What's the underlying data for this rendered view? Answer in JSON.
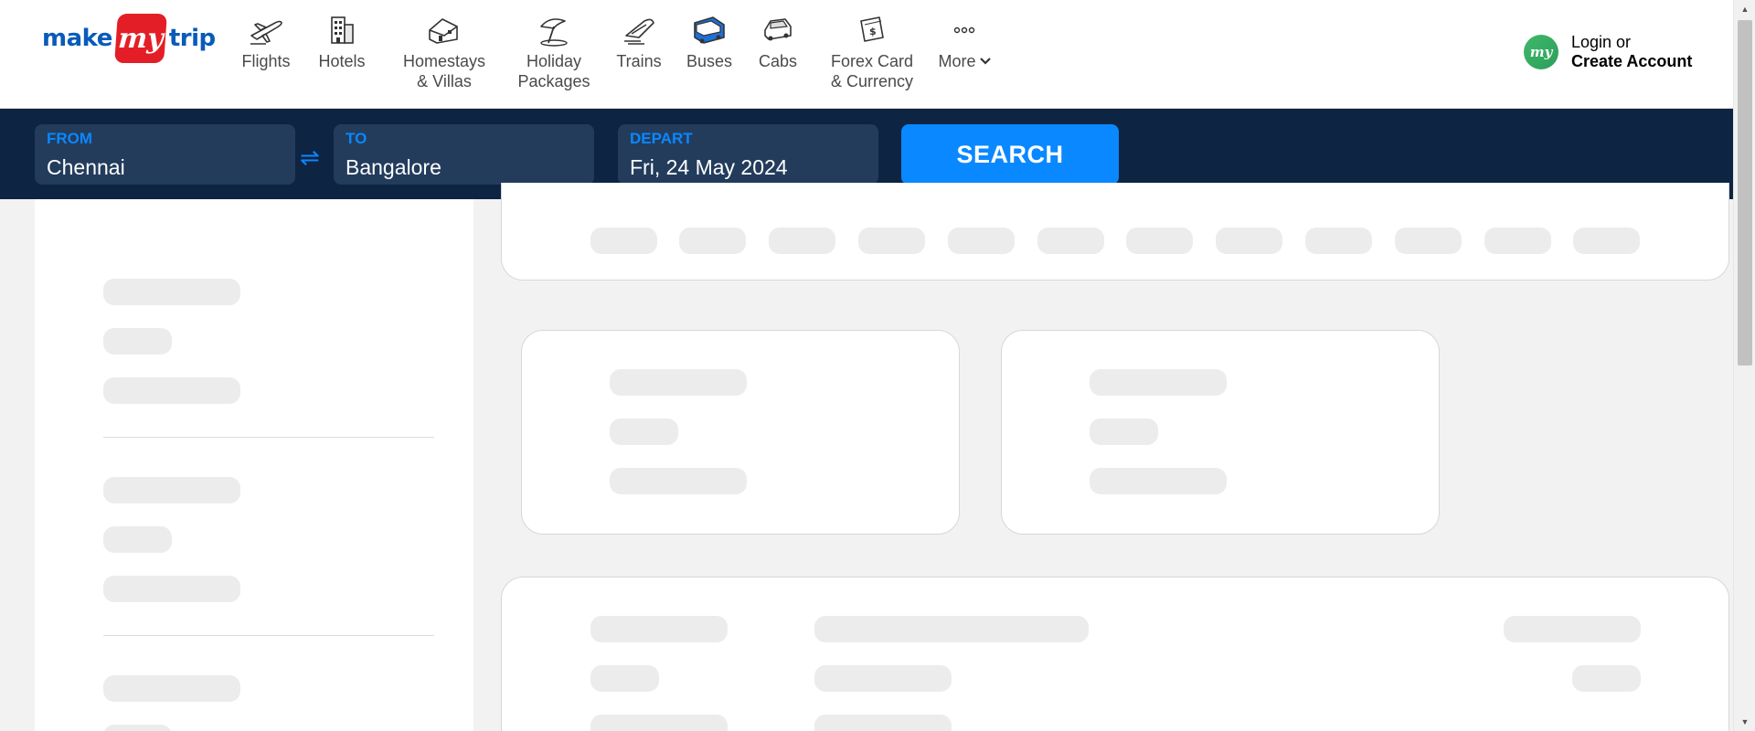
{
  "logo": {
    "pre": "make",
    "badge": "my",
    "post": "trip"
  },
  "nav": [
    {
      "label": "Flights",
      "icon": "flight-icon"
    },
    {
      "label": "Hotels",
      "icon": "hotel-icon"
    },
    {
      "label": "Homestays\n& Villas",
      "icon": "homestay-icon"
    },
    {
      "label": "Holiday\nPackages",
      "icon": "holiday-icon"
    },
    {
      "label": "Trains",
      "icon": "train-icon"
    },
    {
      "label": "Buses",
      "icon": "bus-icon"
    },
    {
      "label": "Cabs",
      "icon": "cab-icon"
    },
    {
      "label": "Forex Card\n& Currency",
      "icon": "forex-icon"
    },
    {
      "label": "More",
      "icon": "more-dots-icon"
    }
  ],
  "login": {
    "avatar": "my",
    "line1": "Login or",
    "line2": "Create Account"
  },
  "search": {
    "from_label": "FROM",
    "from_value": "Chennai",
    "to_label": "TO",
    "to_value": "Bangalore",
    "depart_label": "DEPART",
    "depart_value": "Fri, 24 May 2024",
    "button": "SEARCH",
    "swap_icon": "swap-icon"
  },
  "colors": {
    "brand_blue": "#0a5bb8",
    "brand_red": "#e41e26",
    "search_bg": "#0d2442",
    "accent": "#0a88ff"
  }
}
